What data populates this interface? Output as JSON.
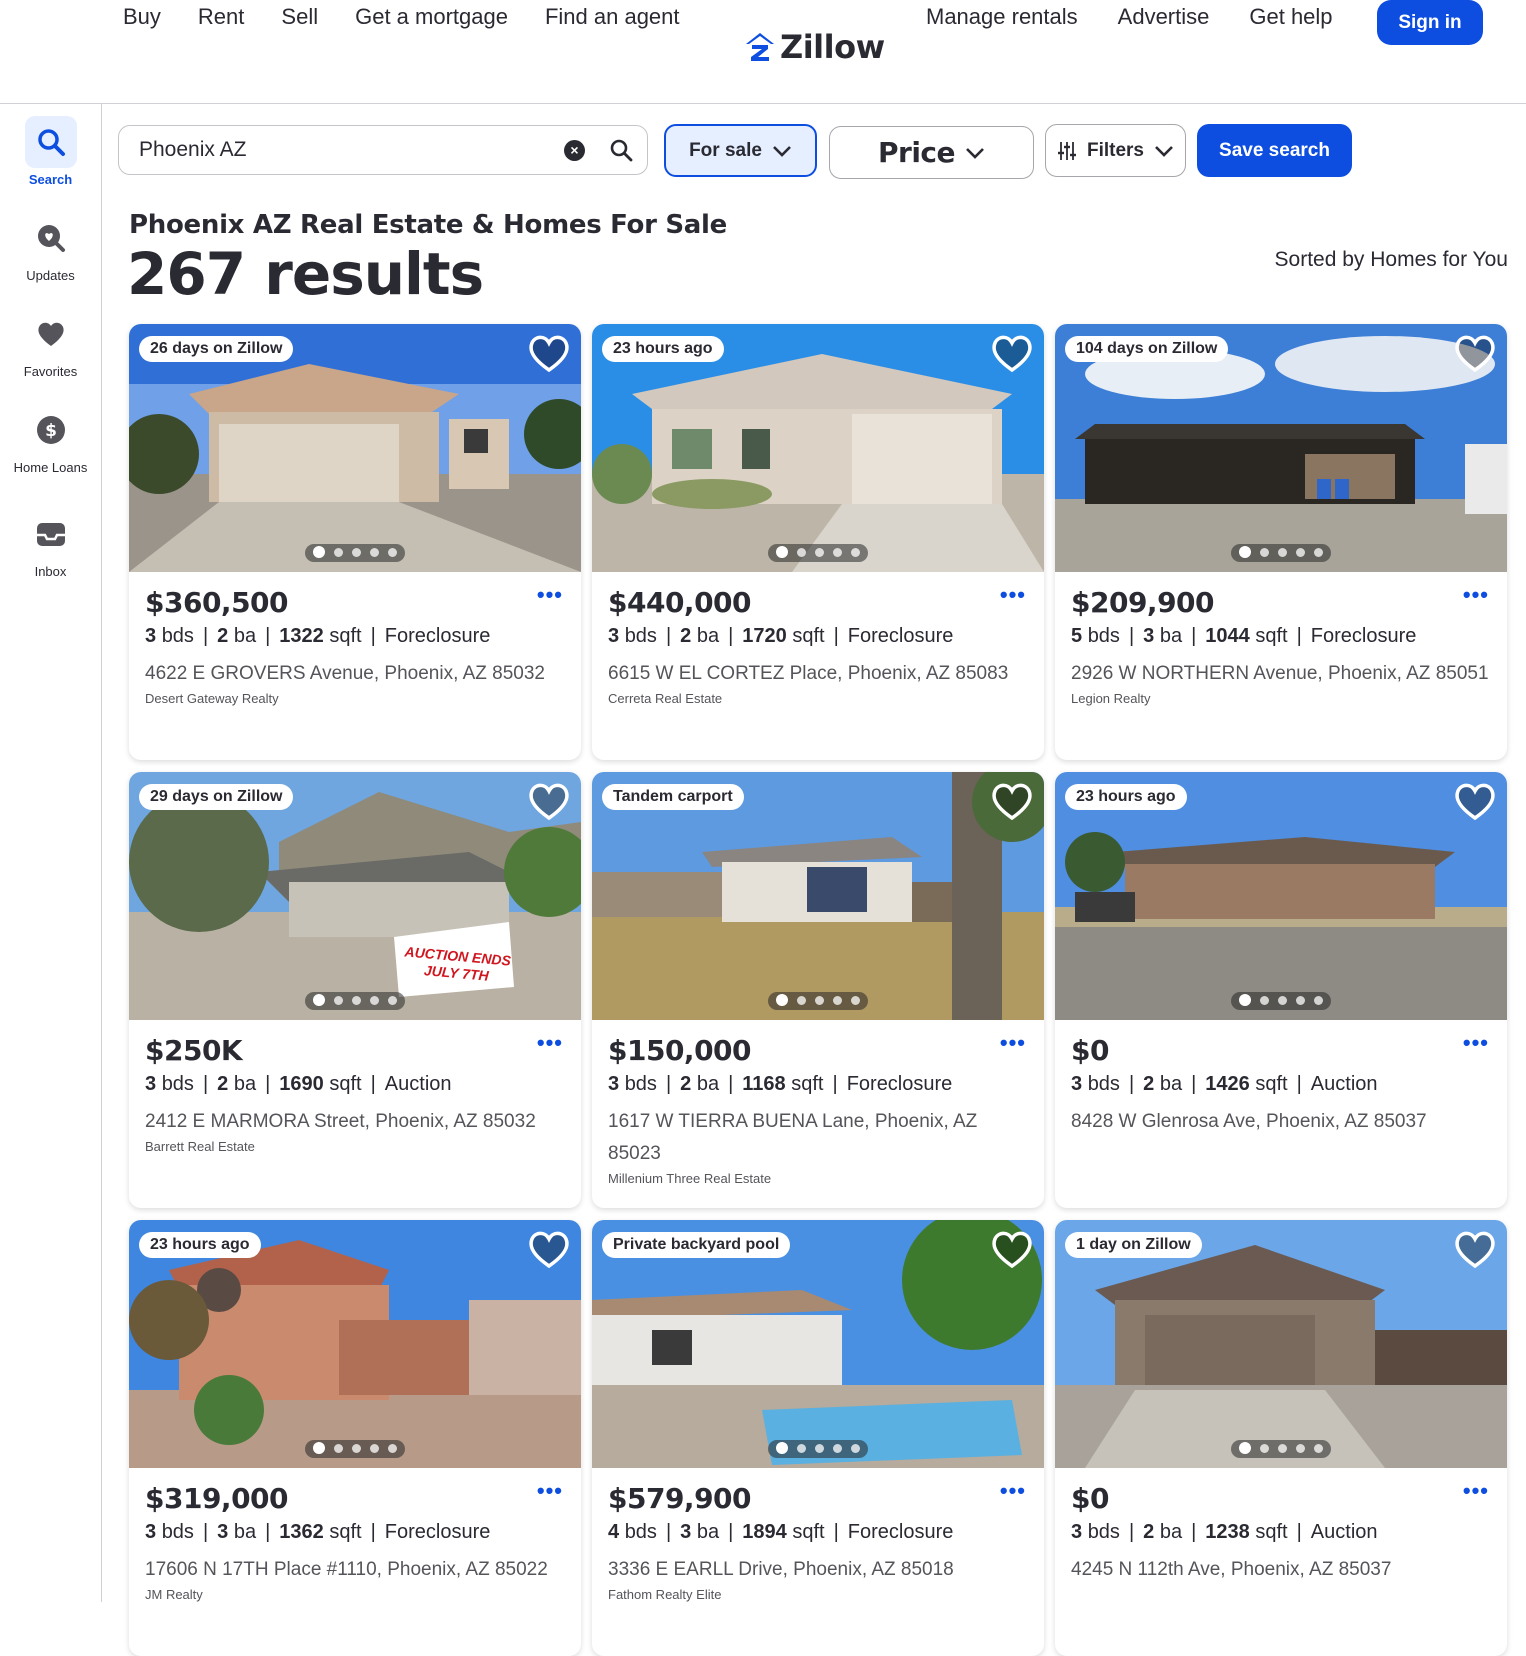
{
  "nav": {
    "left": [
      "Buy",
      "Rent",
      "Sell",
      "Get a mortgage",
      "Find an agent"
    ],
    "right": [
      "Manage rentals",
      "Advertise",
      "Get help"
    ],
    "logo": "Zillow",
    "signin": "Sign in"
  },
  "rail": [
    {
      "label": "Search",
      "icon": "search-icon"
    },
    {
      "label": "Updates",
      "icon": "updates-icon"
    },
    {
      "label": "Favorites",
      "icon": "heart-icon"
    },
    {
      "label": "Home Loans",
      "icon": "dollar-icon"
    },
    {
      "label": "Inbox",
      "icon": "inbox-icon"
    }
  ],
  "search": {
    "value": "Phoenix AZ"
  },
  "filters": {
    "for_sale": "For sale",
    "price": "Price",
    "filters": "Filters",
    "save": "Save search"
  },
  "heading": {
    "title": "Phoenix AZ Real Estate & Homes For Sale",
    "count": "267 results",
    "sorted": "Sorted by Homes for You"
  },
  "listings": [
    {
      "badge": "26 days on Zillow",
      "price": "$360,500",
      "bds": "3",
      "ba": "2",
      "sqft": "1322",
      "type": "Foreclosure",
      "address": "4622 E GROVERS Avenue, Phoenix, AZ 85032",
      "broker": "Desert Gateway Realty"
    },
    {
      "badge": "23 hours ago",
      "price": "$440,000",
      "bds": "3",
      "ba": "2",
      "sqft": "1720",
      "type": "Foreclosure",
      "address": "6615 W EL CORTEZ Place, Phoenix, AZ 85083",
      "broker": "Cerreta Real Estate"
    },
    {
      "badge": "104 days on Zillow",
      "price": "$209,900",
      "bds": "5",
      "ba": "3",
      "sqft": "1044",
      "type": "Foreclosure",
      "address": "2926 W NORTHERN Avenue, Phoenix, AZ 85051",
      "broker": "Legion Realty"
    },
    {
      "badge": "29 days on Zillow",
      "price": "$250K",
      "bds": "3",
      "ba": "2",
      "sqft": "1690",
      "type": "Auction",
      "address": "2412 E MARMORA Street, Phoenix, AZ 85032",
      "broker": "Barrett Real Estate",
      "sign_line1": "AUCTION ENDS",
      "sign_line2": "JULY 7TH"
    },
    {
      "badge": "Tandem carport",
      "price": "$150,000",
      "bds": "3",
      "ba": "2",
      "sqft": "1168",
      "type": "Foreclosure",
      "address": "1617 W TIERRA BUENA Lane, Phoenix, AZ 85023",
      "broker": "Millenium Three Real Estate"
    },
    {
      "badge": "23 hours ago",
      "price": "$0",
      "bds": "3",
      "ba": "2",
      "sqft": "1426",
      "type": "Auction",
      "address": "8428 W Glenrosa Ave, Phoenix, AZ 85037",
      "broker": ""
    },
    {
      "badge": "23 hours ago",
      "price": "$319,000",
      "bds": "3",
      "ba": "3",
      "sqft": "1362",
      "type": "Foreclosure",
      "address": "17606 N 17TH Place #1110, Phoenix, AZ 85022",
      "broker": "JM Realty"
    },
    {
      "badge": "Private backyard pool",
      "price": "$579,900",
      "bds": "4",
      "ba": "3",
      "sqft": "1894",
      "type": "Foreclosure",
      "address": "3336 E EARLL Drive, Phoenix, AZ 85018",
      "broker": "Fathom Realty Elite"
    },
    {
      "badge": "1 day on Zillow",
      "price": "$0",
      "bds": "3",
      "ba": "2",
      "sqft": "1238",
      "type": "Auction",
      "address": "4245 N 112th Ave, Phoenix, AZ 85037",
      "broker": ""
    }
  ],
  "units": {
    "bds": "bds",
    "ba": "ba",
    "sqft": "sqft"
  },
  "colors": {
    "brand": "#0d4ee0",
    "text": "#2a2a33"
  }
}
